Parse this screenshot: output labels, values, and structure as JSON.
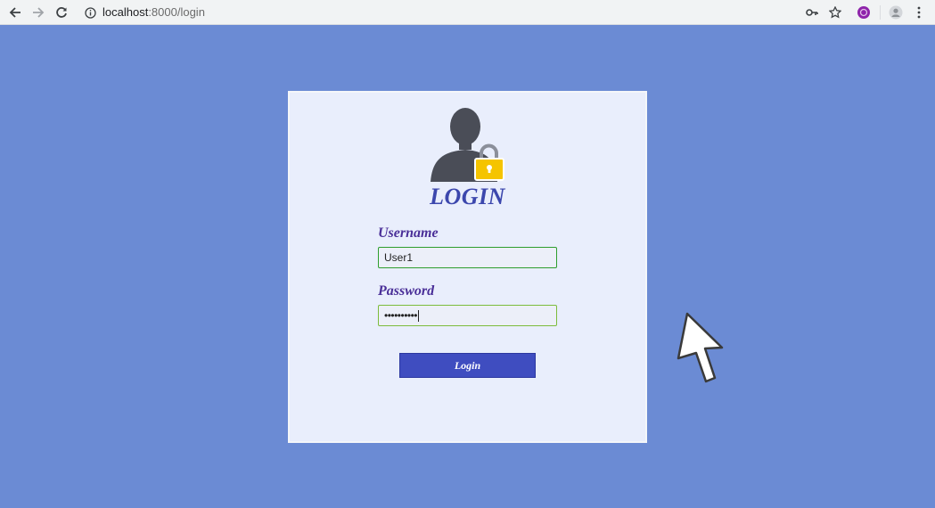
{
  "browser": {
    "url_host": "localhost",
    "url_path": ":8000/login"
  },
  "login": {
    "title": "LOGIN",
    "username_label": "Username",
    "username_value": "User1",
    "password_label": "Password",
    "password_masked": "••••••••••",
    "button_label": "Login"
  },
  "colors": {
    "page_background": "#6b8bd4",
    "card_background": "#e9eefc",
    "accent": "#3f4dc0",
    "title": "#3c47ad",
    "label": "#4a2f98",
    "lock": "#f5c400",
    "profile_badge": "#8e24aa"
  },
  "icons": [
    "back-arrow-icon",
    "forward-arrow-icon",
    "reload-icon",
    "info-icon",
    "key-icon",
    "star-icon",
    "extension-icon",
    "profile-icon",
    "menu-icon",
    "user-lock-icon",
    "cursor-arrow-icon"
  ]
}
